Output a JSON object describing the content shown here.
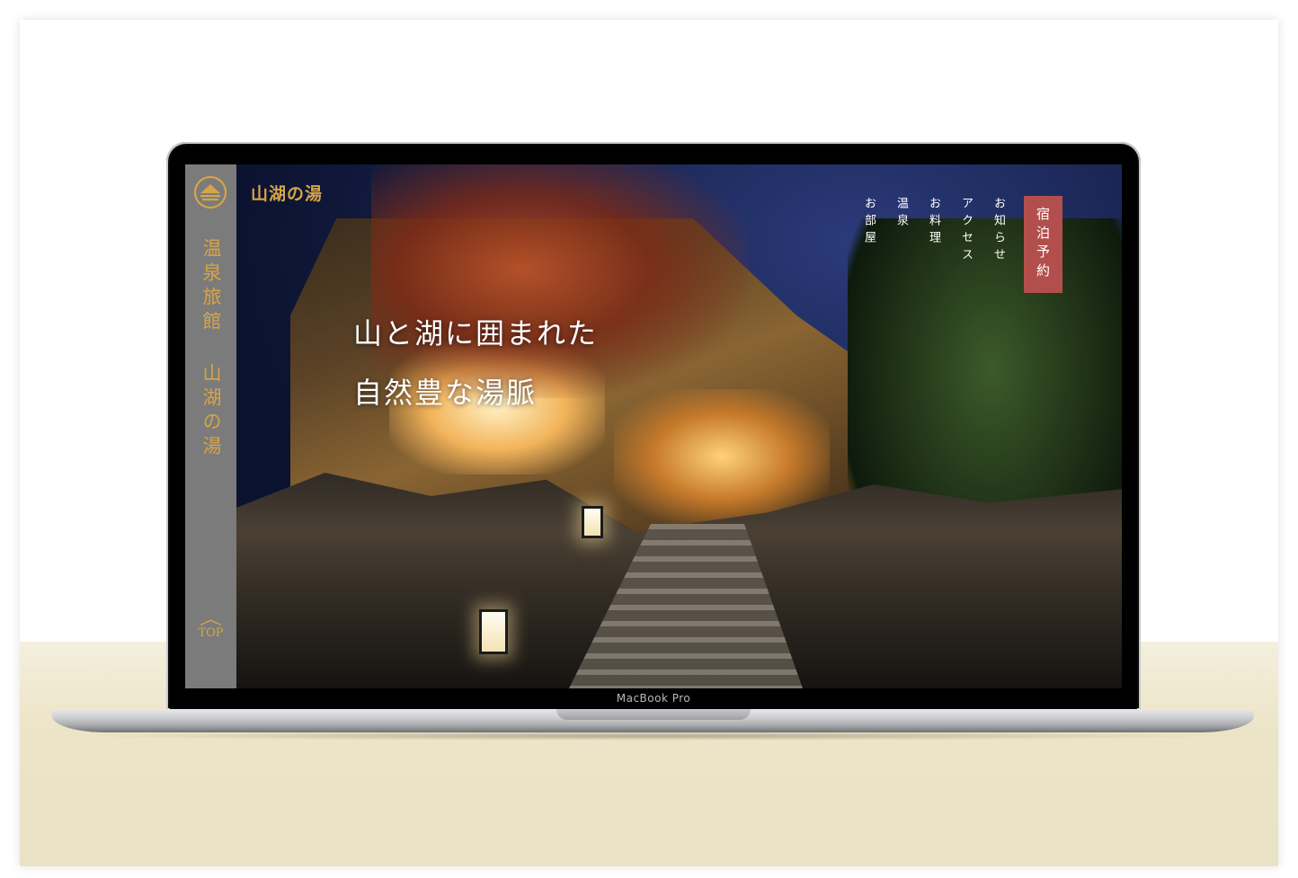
{
  "site": {
    "brand": "山湖の湯",
    "sidebar_title_1": "温泉旅館",
    "sidebar_title_2": "山湖の湯",
    "top_label": "TOP",
    "top_icon": "chevron-up-icon",
    "logo_icon": "lake-mountain-crest-icon"
  },
  "nav": {
    "items": [
      "お知らせ",
      "アクセス",
      "お料理",
      "温泉",
      "お部屋"
    ],
    "reserve_label": "宿泊予約"
  },
  "hero": {
    "line1": "山と湖に囲まれた",
    "line2": "自然豊な湯脈"
  },
  "device": {
    "label": "MacBook Pro"
  },
  "colors": {
    "accent_gold": "#d6a548",
    "sidebar_gray": "#7b7b7b",
    "reserve_red": "#b24f4d"
  }
}
